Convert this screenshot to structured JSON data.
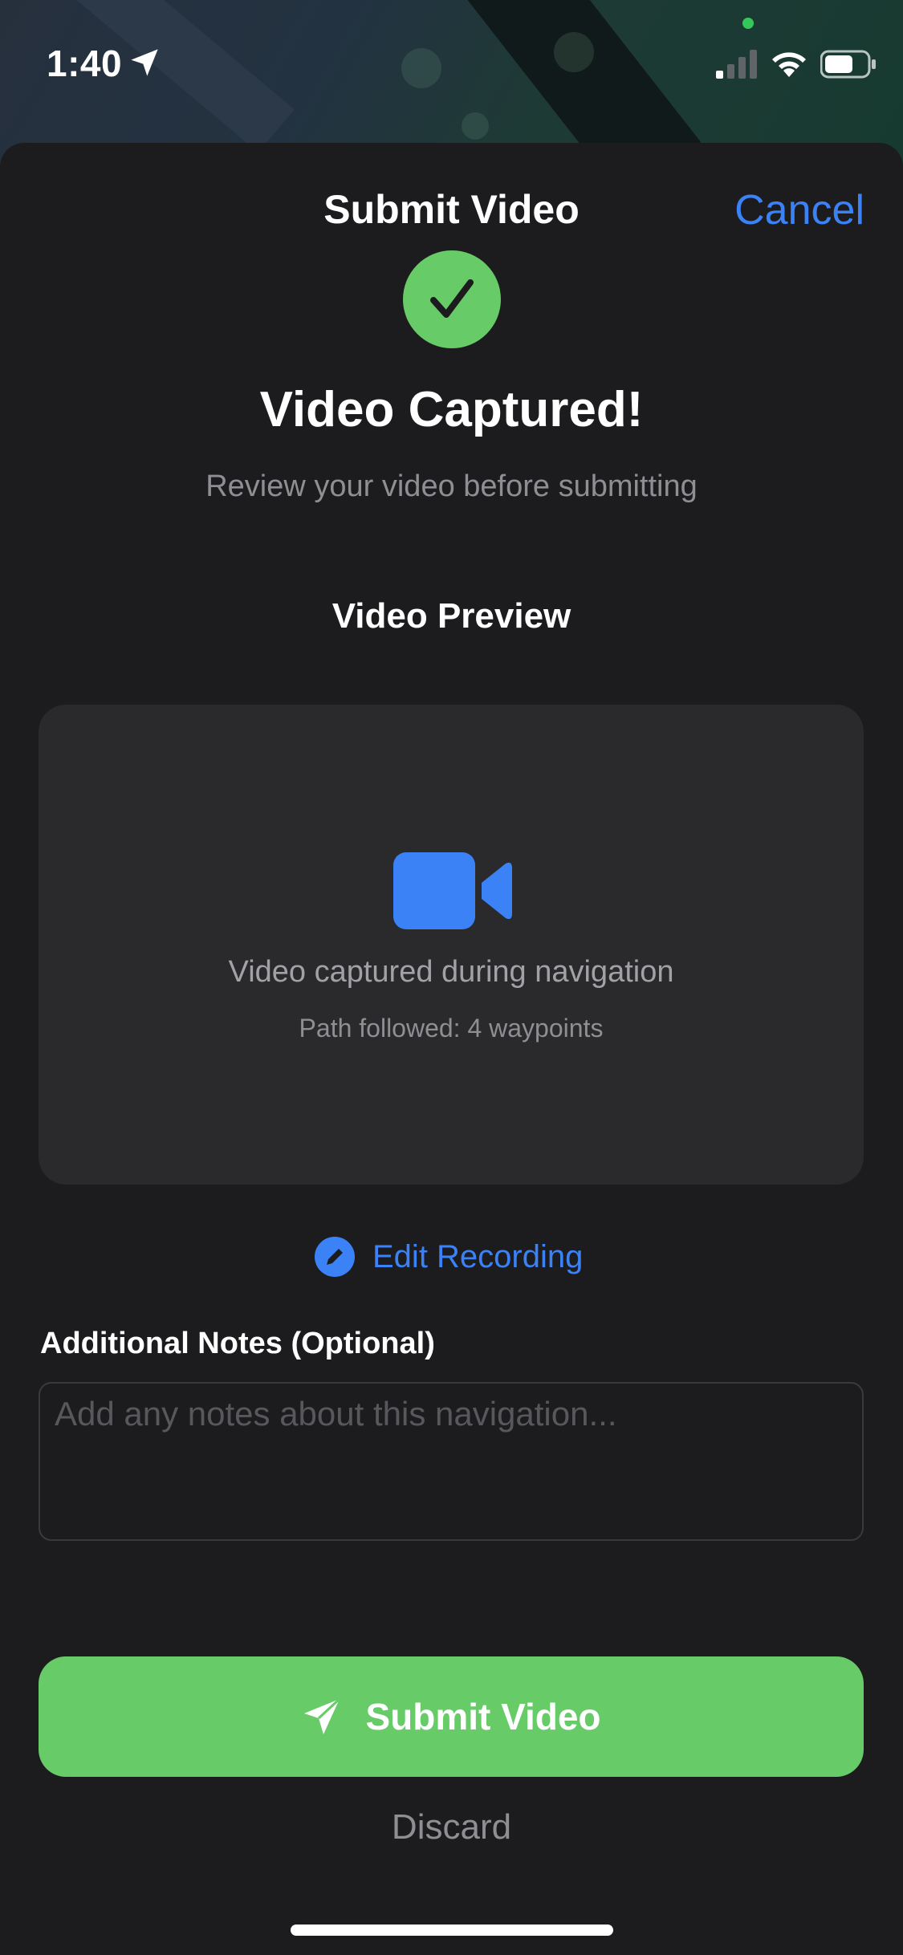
{
  "status_bar": {
    "time": "1:40",
    "icons": [
      "location-arrow-icon",
      "signal-icon",
      "wifi-icon",
      "battery-icon"
    ],
    "signal_bars_filled": 1,
    "signal_bars_total": 4,
    "battery_level": 0.6
  },
  "sheet": {
    "title": "Submit Video",
    "cancel_label": "Cancel"
  },
  "success": {
    "icon": "checkmark-icon",
    "headline": "Video Captured!",
    "subhead": "Review your video before submitting"
  },
  "preview": {
    "section_title": "Video Preview",
    "icon": "video-camera-icon",
    "caption": "Video captured during navigation",
    "detail": "Path followed: 4 waypoints"
  },
  "edit": {
    "label": "Edit Recording",
    "icon": "pencil-icon"
  },
  "notes": {
    "label": "Additional Notes (Optional)",
    "placeholder": "Add any notes about this navigation...",
    "value": ""
  },
  "actions": {
    "submit_label": "Submit Video",
    "submit_icon": "paper-plane-icon",
    "discard_label": "Discard"
  },
  "colors": {
    "accent_blue": "#3b82f6",
    "success_green": "#67cb68",
    "background": "#1c1c1e",
    "card": "#2a2a2c",
    "secondary_text": "#8e8e93"
  }
}
